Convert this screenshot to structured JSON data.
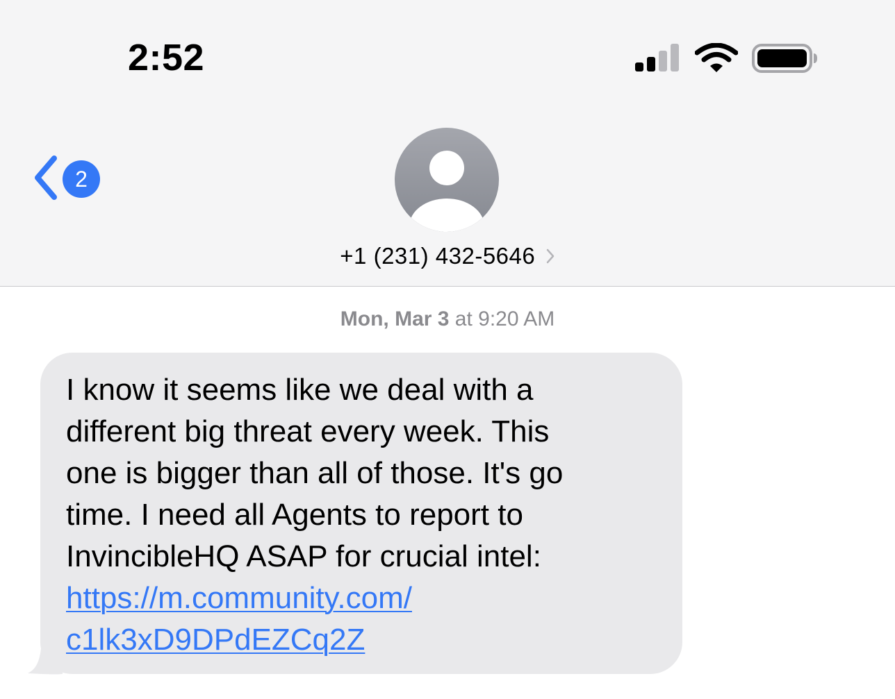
{
  "status_bar": {
    "time": "2:52",
    "signal_bars_active": 2,
    "signal_bars_total": 4,
    "icons": [
      "signal-icon",
      "wifi-icon",
      "battery-icon"
    ]
  },
  "header": {
    "back_badge_count": "2",
    "contact_name": "+1 (231) 432-5646",
    "avatar_icon": "person-placeholder-icon",
    "colors": {
      "accent": "#3478f6",
      "header_bg": "#f5f5f6",
      "avatar": "#9a9ca3"
    }
  },
  "conversation": {
    "timestamp_day": "Mon, Mar 3",
    "timestamp_time": "at 9:20 AM",
    "messages": [
      {
        "direction": "incoming",
        "bubble_color": "#e9e9eb",
        "text_lines": [
          "I know it seems like we deal with a",
          "different big threat every week. This",
          "one is bigger than all of those. It's go",
          "time. I need all Agents to report to",
          "InvincibleHQ ASAP for crucial intel:"
        ],
        "link_lines": [
          "https://m.community.com/",
          "c1lk3xD9DPdEZCq2Z"
        ]
      }
    ]
  }
}
